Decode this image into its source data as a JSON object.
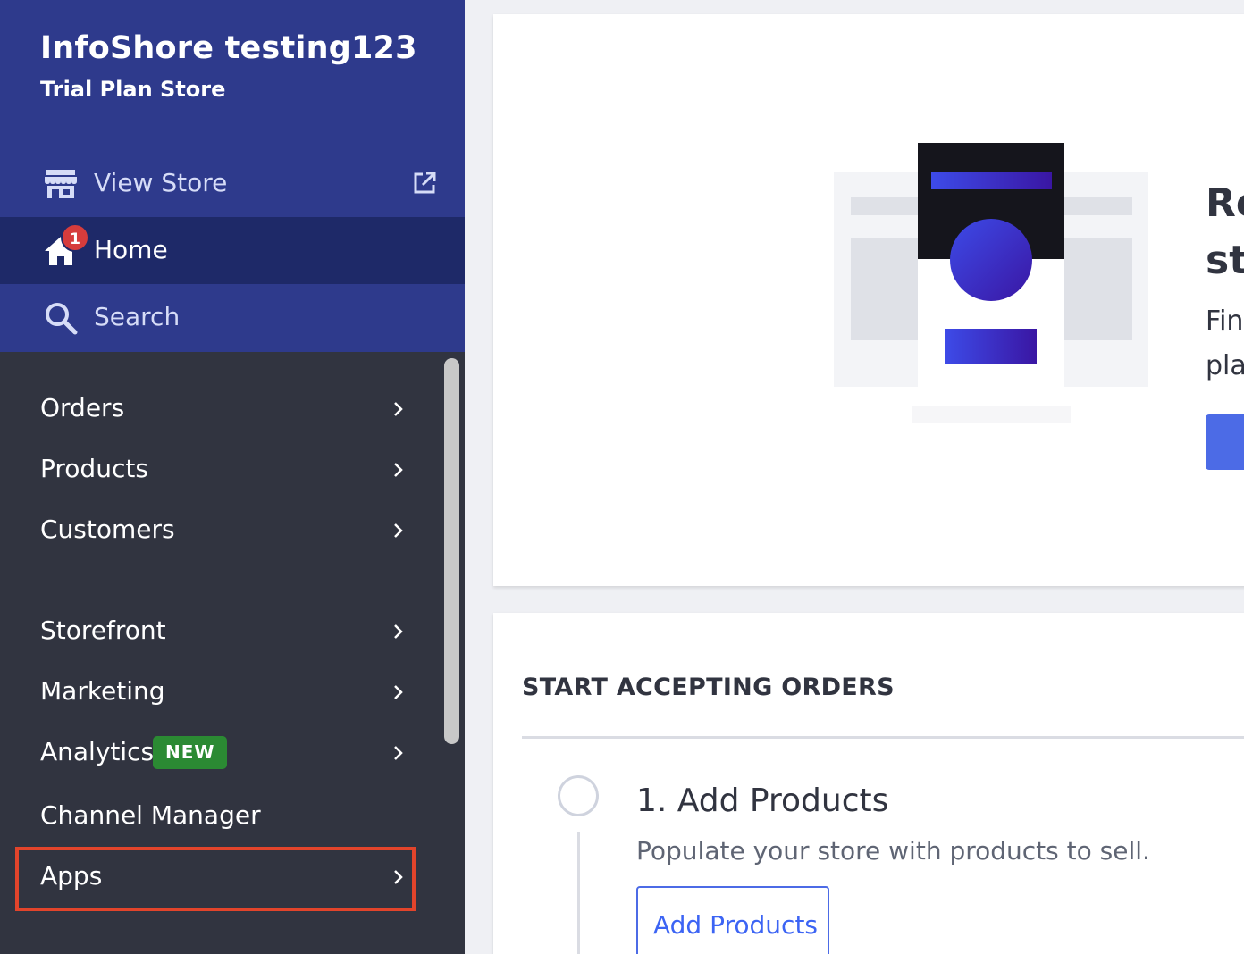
{
  "store": {
    "name": "InfoShore testing123",
    "plan": "Trial Plan Store"
  },
  "top_nav": {
    "view_store": "View Store",
    "home": "Home",
    "home_badge": "1",
    "search": "Search"
  },
  "nav": {
    "orders": "Orders",
    "products": "Products",
    "customers": "Customers",
    "storefront": "Storefront",
    "marketing": "Marketing",
    "analytics": "Analytics",
    "analytics_badge": "NEW",
    "channel_manager": "Channel Manager",
    "apps": "Apps"
  },
  "hero": {
    "title_line1": "Re",
    "title_line2": "st",
    "text_line1": "Fin",
    "text_line2": "pla"
  },
  "onboarding": {
    "section_title": "START ACCEPTING ORDERS",
    "step1_title": "1. Add Products",
    "step1_desc": "Populate your store with products to sell.",
    "step1_button": "Add Products"
  },
  "colors": {
    "sidebar_top": "#2e3a8c",
    "sidebar_active": "#1e2968",
    "sidebar_bg": "#313440",
    "accent": "#4c6be6",
    "new_badge": "#2b8a33",
    "highlight": "#e2442b"
  }
}
